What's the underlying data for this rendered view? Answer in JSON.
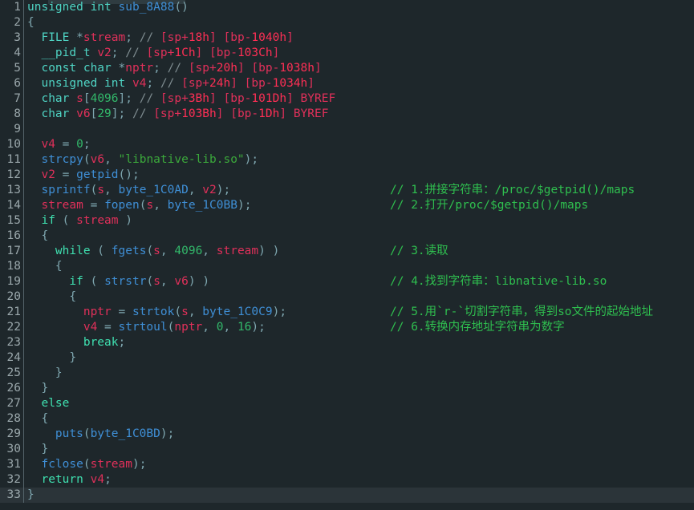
{
  "editor": {
    "kind": "decompiler-pseudocode-view",
    "function_name": "sub_8A88",
    "current_line": 33,
    "total_lines": 33,
    "colors": {
      "background": "#1e272b",
      "gutter_text": "#9aa7ab",
      "gutter_rule": "#55646a",
      "current_line_bg": "#2b3439",
      "keyword": "#3fe0b0",
      "type": "#4fd4c4",
      "function": "#3f8fd6",
      "variable": "#e0305a",
      "string": "#3ba83b",
      "number": "#32b86a",
      "punctuation": "#7fa7b0",
      "comment_marker": "#7e8c90",
      "stack_offset": "#e0305a",
      "note_comment": "#2fbf4f",
      "top_strip": "#2f3c41"
    }
  },
  "lines": [
    {
      "n": "1",
      "tokens": [
        {
          "t": "unsigned int ",
          "c": "t-type"
        },
        {
          "t": "sub_8A88",
          "c": "t-fn"
        },
        {
          "t": "()",
          "c": "t-punct"
        }
      ],
      "note": ""
    },
    {
      "n": "2",
      "tokens": [
        {
          "t": "{",
          "c": "t-punct"
        }
      ],
      "note": ""
    },
    {
      "n": "3",
      "tokens": [
        {
          "t": "  ",
          "c": "t-plain"
        },
        {
          "t": "FILE ",
          "c": "t-type"
        },
        {
          "t": "*",
          "c": "t-punct"
        },
        {
          "t": "stream",
          "c": "t-var"
        },
        {
          "t": ";",
          "c": "t-punct"
        },
        {
          "t": " // ",
          "c": "t-cmt"
        },
        {
          "t": "[sp+",
          "c": "t-stk"
        },
        {
          "t": "18h",
          "c": "t-stkh"
        },
        {
          "t": "] [bp-",
          "c": "t-stk"
        },
        {
          "t": "1040h",
          "c": "t-stkh"
        },
        {
          "t": "]",
          "c": "t-stk"
        }
      ],
      "note": ""
    },
    {
      "n": "4",
      "tokens": [
        {
          "t": "  ",
          "c": "t-plain"
        },
        {
          "t": "__pid_t ",
          "c": "t-type"
        },
        {
          "t": "v2",
          "c": "t-var"
        },
        {
          "t": ";",
          "c": "t-punct"
        },
        {
          "t": " // ",
          "c": "t-cmt"
        },
        {
          "t": "[sp+",
          "c": "t-stk"
        },
        {
          "t": "1Ch",
          "c": "t-stkh"
        },
        {
          "t": "] [bp-",
          "c": "t-stk"
        },
        {
          "t": "103Ch",
          "c": "t-stkh"
        },
        {
          "t": "]",
          "c": "t-stk"
        }
      ],
      "note": ""
    },
    {
      "n": "5",
      "tokens": [
        {
          "t": "  ",
          "c": "t-plain"
        },
        {
          "t": "const char ",
          "c": "t-type"
        },
        {
          "t": "*",
          "c": "t-punct"
        },
        {
          "t": "nptr",
          "c": "t-var"
        },
        {
          "t": ";",
          "c": "t-punct"
        },
        {
          "t": " // ",
          "c": "t-cmt"
        },
        {
          "t": "[sp+",
          "c": "t-stk"
        },
        {
          "t": "20h",
          "c": "t-stkh"
        },
        {
          "t": "] [bp-",
          "c": "t-stk"
        },
        {
          "t": "1038h",
          "c": "t-stkh"
        },
        {
          "t": "]",
          "c": "t-stk"
        }
      ],
      "note": ""
    },
    {
      "n": "6",
      "tokens": [
        {
          "t": "  ",
          "c": "t-plain"
        },
        {
          "t": "unsigned int ",
          "c": "t-type"
        },
        {
          "t": "v4",
          "c": "t-var"
        },
        {
          "t": ";",
          "c": "t-punct"
        },
        {
          "t": " // ",
          "c": "t-cmt"
        },
        {
          "t": "[sp+",
          "c": "t-stk"
        },
        {
          "t": "24h",
          "c": "t-stkh"
        },
        {
          "t": "] [bp-",
          "c": "t-stk"
        },
        {
          "t": "1034h",
          "c": "t-stkh"
        },
        {
          "t": "]",
          "c": "t-stk"
        }
      ],
      "note": ""
    },
    {
      "n": "7",
      "tokens": [
        {
          "t": "  ",
          "c": "t-plain"
        },
        {
          "t": "char ",
          "c": "t-type"
        },
        {
          "t": "s",
          "c": "t-var"
        },
        {
          "t": "[",
          "c": "t-punct"
        },
        {
          "t": "4096",
          "c": "t-num"
        },
        {
          "t": "];",
          "c": "t-punct"
        },
        {
          "t": " // ",
          "c": "t-cmt"
        },
        {
          "t": "[sp+",
          "c": "t-stk"
        },
        {
          "t": "3Bh",
          "c": "t-stkh"
        },
        {
          "t": "] [bp-",
          "c": "t-stk"
        },
        {
          "t": "101Dh",
          "c": "t-stkh"
        },
        {
          "t": "] BYREF",
          "c": "t-stk"
        }
      ],
      "note": ""
    },
    {
      "n": "8",
      "tokens": [
        {
          "t": "  ",
          "c": "t-plain"
        },
        {
          "t": "char ",
          "c": "t-type"
        },
        {
          "t": "v6",
          "c": "t-var"
        },
        {
          "t": "[",
          "c": "t-punct"
        },
        {
          "t": "29",
          "c": "t-num"
        },
        {
          "t": "];",
          "c": "t-punct"
        },
        {
          "t": " // ",
          "c": "t-cmt"
        },
        {
          "t": "[sp+",
          "c": "t-stk"
        },
        {
          "t": "103Bh",
          "c": "t-stkh"
        },
        {
          "t": "] [bp-",
          "c": "t-stk"
        },
        {
          "t": "1Dh",
          "c": "t-stkh"
        },
        {
          "t": "] BYREF",
          "c": "t-stk"
        }
      ],
      "note": ""
    },
    {
      "n": "9",
      "tokens": [],
      "note": ""
    },
    {
      "n": "10",
      "tokens": [
        {
          "t": "  ",
          "c": "t-plain"
        },
        {
          "t": "v4",
          "c": "t-var"
        },
        {
          "t": " = ",
          "c": "t-punct"
        },
        {
          "t": "0",
          "c": "t-num"
        },
        {
          "t": ";",
          "c": "t-punct"
        }
      ],
      "note": ""
    },
    {
      "n": "11",
      "tokens": [
        {
          "t": "  ",
          "c": "t-plain"
        },
        {
          "t": "strcpy",
          "c": "t-fn"
        },
        {
          "t": "(",
          "c": "t-punct"
        },
        {
          "t": "v6",
          "c": "t-var"
        },
        {
          "t": ", ",
          "c": "t-punct"
        },
        {
          "t": "\"libnative-lib.so\"",
          "c": "t-str"
        },
        {
          "t": ");",
          "c": "t-punct"
        }
      ],
      "note": ""
    },
    {
      "n": "12",
      "tokens": [
        {
          "t": "  ",
          "c": "t-plain"
        },
        {
          "t": "v2",
          "c": "t-var"
        },
        {
          "t": " = ",
          "c": "t-punct"
        },
        {
          "t": "getpid",
          "c": "t-fn"
        },
        {
          "t": "();",
          "c": "t-punct"
        }
      ],
      "note": ""
    },
    {
      "n": "13",
      "tokens": [
        {
          "t": "  ",
          "c": "t-plain"
        },
        {
          "t": "sprintf",
          "c": "t-fn"
        },
        {
          "t": "(",
          "c": "t-punct"
        },
        {
          "t": "s",
          "c": "t-var"
        },
        {
          "t": ", ",
          "c": "t-punct"
        },
        {
          "t": "byte_1C0AD",
          "c": "t-fn"
        },
        {
          "t": ", ",
          "c": "t-punct"
        },
        {
          "t": "v2",
          "c": "t-var"
        },
        {
          "t": ");",
          "c": "t-punct"
        }
      ],
      "note": "// 1.拼接字符串：/proc/$getpid()/maps"
    },
    {
      "n": "14",
      "tokens": [
        {
          "t": "  ",
          "c": "t-plain"
        },
        {
          "t": "stream",
          "c": "t-var"
        },
        {
          "t": " = ",
          "c": "t-punct"
        },
        {
          "t": "fopen",
          "c": "t-fn"
        },
        {
          "t": "(",
          "c": "t-punct"
        },
        {
          "t": "s",
          "c": "t-var"
        },
        {
          "t": ", ",
          "c": "t-punct"
        },
        {
          "t": "byte_1C0BB",
          "c": "t-fn"
        },
        {
          "t": ");",
          "c": "t-punct"
        }
      ],
      "note": "// 2.打开/proc/$getpid()/maps"
    },
    {
      "n": "15",
      "tokens": [
        {
          "t": "  ",
          "c": "t-plain"
        },
        {
          "t": "if",
          "c": "t-kw"
        },
        {
          "t": " ( ",
          "c": "t-punct"
        },
        {
          "t": "stream",
          "c": "t-var"
        },
        {
          "t": " )",
          "c": "t-punct"
        }
      ],
      "note": ""
    },
    {
      "n": "16",
      "tokens": [
        {
          "t": "  ",
          "c": "t-plain"
        },
        {
          "t": "{",
          "c": "t-punct"
        }
      ],
      "note": ""
    },
    {
      "n": "17",
      "tokens": [
        {
          "t": "    ",
          "c": "t-plain"
        },
        {
          "t": "while",
          "c": "t-kw"
        },
        {
          "t": " ( ",
          "c": "t-punct"
        },
        {
          "t": "fgets",
          "c": "t-fn"
        },
        {
          "t": "(",
          "c": "t-punct"
        },
        {
          "t": "s",
          "c": "t-var"
        },
        {
          "t": ", ",
          "c": "t-punct"
        },
        {
          "t": "4096",
          "c": "t-num"
        },
        {
          "t": ", ",
          "c": "t-punct"
        },
        {
          "t": "stream",
          "c": "t-var"
        },
        {
          "t": ") )",
          "c": "t-punct"
        }
      ],
      "note": "// 3.读取"
    },
    {
      "n": "18",
      "tokens": [
        {
          "t": "    ",
          "c": "t-plain"
        },
        {
          "t": "{",
          "c": "t-punct"
        }
      ],
      "note": ""
    },
    {
      "n": "19",
      "tokens": [
        {
          "t": "      ",
          "c": "t-plain"
        },
        {
          "t": "if",
          "c": "t-kw"
        },
        {
          "t": " ( ",
          "c": "t-punct"
        },
        {
          "t": "strstr",
          "c": "t-fn"
        },
        {
          "t": "(",
          "c": "t-punct"
        },
        {
          "t": "s",
          "c": "t-var"
        },
        {
          "t": ", ",
          "c": "t-punct"
        },
        {
          "t": "v6",
          "c": "t-var"
        },
        {
          "t": ") )",
          "c": "t-punct"
        }
      ],
      "note": "// 4.找到字符串：libnative-lib.so"
    },
    {
      "n": "20",
      "tokens": [
        {
          "t": "      ",
          "c": "t-plain"
        },
        {
          "t": "{",
          "c": "t-punct"
        }
      ],
      "note": ""
    },
    {
      "n": "21",
      "tokens": [
        {
          "t": "        ",
          "c": "t-plain"
        },
        {
          "t": "nptr",
          "c": "t-var"
        },
        {
          "t": " = ",
          "c": "t-punct"
        },
        {
          "t": "strtok",
          "c": "t-fn"
        },
        {
          "t": "(",
          "c": "t-punct"
        },
        {
          "t": "s",
          "c": "t-var"
        },
        {
          "t": ", ",
          "c": "t-punct"
        },
        {
          "t": "byte_1C0C9",
          "c": "t-fn"
        },
        {
          "t": ");",
          "c": "t-punct"
        }
      ],
      "note": "// 5.用`r-`切割字符串，得到so文件的起始地址"
    },
    {
      "n": "22",
      "tokens": [
        {
          "t": "        ",
          "c": "t-plain"
        },
        {
          "t": "v4",
          "c": "t-var"
        },
        {
          "t": " = ",
          "c": "t-punct"
        },
        {
          "t": "strtoul",
          "c": "t-fn"
        },
        {
          "t": "(",
          "c": "t-punct"
        },
        {
          "t": "nptr",
          "c": "t-var"
        },
        {
          "t": ", ",
          "c": "t-punct"
        },
        {
          "t": "0",
          "c": "t-num"
        },
        {
          "t": ", ",
          "c": "t-punct"
        },
        {
          "t": "16",
          "c": "t-num"
        },
        {
          "t": ");",
          "c": "t-punct"
        }
      ],
      "note": "// 6.转换内存地址字符串为数字"
    },
    {
      "n": "23",
      "tokens": [
        {
          "t": "        ",
          "c": "t-plain"
        },
        {
          "t": "break",
          "c": "t-kw"
        },
        {
          "t": ";",
          "c": "t-punct"
        }
      ],
      "note": ""
    },
    {
      "n": "24",
      "tokens": [
        {
          "t": "      ",
          "c": "t-plain"
        },
        {
          "t": "}",
          "c": "t-punct"
        }
      ],
      "note": ""
    },
    {
      "n": "25",
      "tokens": [
        {
          "t": "    ",
          "c": "t-plain"
        },
        {
          "t": "}",
          "c": "t-punct"
        }
      ],
      "note": ""
    },
    {
      "n": "26",
      "tokens": [
        {
          "t": "  ",
          "c": "t-plain"
        },
        {
          "t": "}",
          "c": "t-punct"
        }
      ],
      "note": ""
    },
    {
      "n": "27",
      "tokens": [
        {
          "t": "  ",
          "c": "t-plain"
        },
        {
          "t": "else",
          "c": "t-kw"
        }
      ],
      "note": ""
    },
    {
      "n": "28",
      "tokens": [
        {
          "t": "  ",
          "c": "t-plain"
        },
        {
          "t": "{",
          "c": "t-punct"
        }
      ],
      "note": ""
    },
    {
      "n": "29",
      "tokens": [
        {
          "t": "    ",
          "c": "t-plain"
        },
        {
          "t": "puts",
          "c": "t-fn"
        },
        {
          "t": "(",
          "c": "t-punct"
        },
        {
          "t": "byte_1C0BD",
          "c": "t-fn"
        },
        {
          "t": ");",
          "c": "t-punct"
        }
      ],
      "note": ""
    },
    {
      "n": "30",
      "tokens": [
        {
          "t": "  ",
          "c": "t-plain"
        },
        {
          "t": "}",
          "c": "t-punct"
        }
      ],
      "note": ""
    },
    {
      "n": "31",
      "tokens": [
        {
          "t": "  ",
          "c": "t-plain"
        },
        {
          "t": "fclose",
          "c": "t-fn"
        },
        {
          "t": "(",
          "c": "t-punct"
        },
        {
          "t": "stream",
          "c": "t-var"
        },
        {
          "t": ");",
          "c": "t-punct"
        }
      ],
      "note": ""
    },
    {
      "n": "32",
      "tokens": [
        {
          "t": "  ",
          "c": "t-plain"
        },
        {
          "t": "return",
          "c": "t-kw"
        },
        {
          "t": " ",
          "c": "t-plain"
        },
        {
          "t": "v4",
          "c": "t-var"
        },
        {
          "t": ";",
          "c": "t-punct"
        }
      ],
      "note": ""
    },
    {
      "n": "33",
      "tokens": [
        {
          "t": "}",
          "c": "t-punct"
        }
      ],
      "note": "",
      "current": true
    }
  ]
}
